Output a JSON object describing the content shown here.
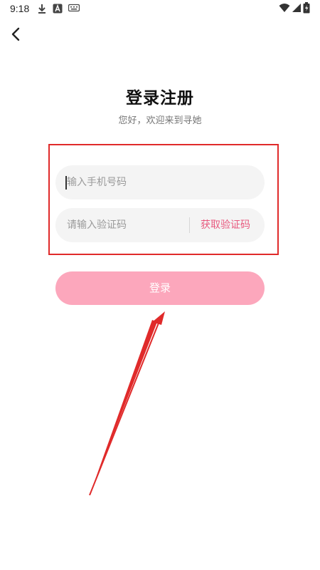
{
  "status_bar": {
    "time": "9:18",
    "icons": [
      "download-icon",
      "a-badge-icon",
      "keyboard-icon",
      "wifi-icon",
      "signal-icon",
      "battery-icon"
    ]
  },
  "header": {
    "back_icon": "chevron-left-icon"
  },
  "main": {
    "title": "登录注册",
    "subtitle": "您好，欢迎来到寻她"
  },
  "form": {
    "phone_placeholder": "输入手机号码",
    "code_placeholder": "请输入验证码",
    "get_code_label": "获取验证码",
    "login_label": "登录"
  },
  "colors": {
    "accent": "#e85a7f",
    "login_button": "#fca7bc",
    "field_bg": "#f4f4f4",
    "annotation": "#e02a2a"
  }
}
